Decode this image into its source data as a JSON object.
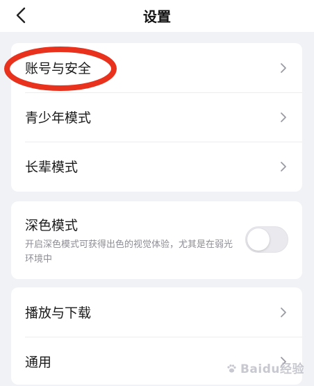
{
  "header": {
    "title": "设置",
    "back_icon": "chevron-left-icon"
  },
  "section_account": {
    "items": [
      {
        "label": "账号与安全",
        "icon": "chevron-right-icon"
      },
      {
        "label": "青少年模式",
        "icon": "chevron-right-icon"
      },
      {
        "label": "长辈模式",
        "icon": "chevron-right-icon"
      }
    ]
  },
  "section_display": {
    "dark_mode": {
      "label": "深色模式",
      "description": "开启深色模式可获得出色的视觉体验，尤其是在弱光环境中",
      "enabled": false
    }
  },
  "section_general": {
    "items": [
      {
        "label": "播放与下载",
        "icon": "chevron-right-icon"
      },
      {
        "label": "通用",
        "icon": "chevron-right-icon"
      }
    ]
  },
  "annotation": {
    "highlight_color": "#e8321e"
  },
  "watermark": {
    "text": "Baidu经验"
  },
  "colors": {
    "background": "#f1f2f6",
    "card": "#ffffff",
    "text": "#1a1a1a",
    "secondary_text": "#8d8d95",
    "chevron": "#9a9aa3"
  }
}
